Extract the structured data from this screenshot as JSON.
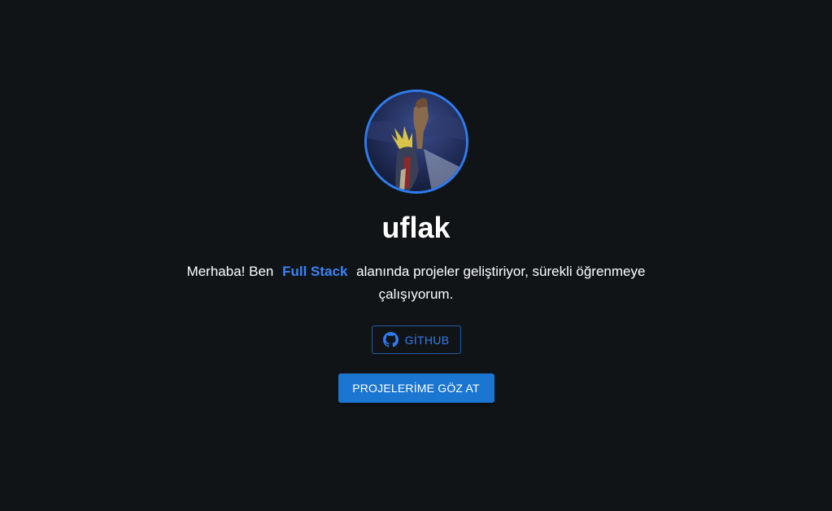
{
  "profile": {
    "name": "uflak",
    "avatar_icon": "profile-avatar-image",
    "bio_before": "Merhaba! Ben",
    "bio_highlight": "Full Stack",
    "bio_after": "alanında projeler geliştiriyor, sürekli öğrenmeye çalışıyorum."
  },
  "buttons": {
    "github_label": "GİTHUB",
    "github_icon": "github-icon",
    "projects_label": "PROJELERİME GÖZ AT"
  },
  "colors": {
    "background": "#111417",
    "accent": "#2f7cf0",
    "highlight": "#3b82f6",
    "primary_button": "#1b76d2",
    "text": "#ffffff"
  }
}
